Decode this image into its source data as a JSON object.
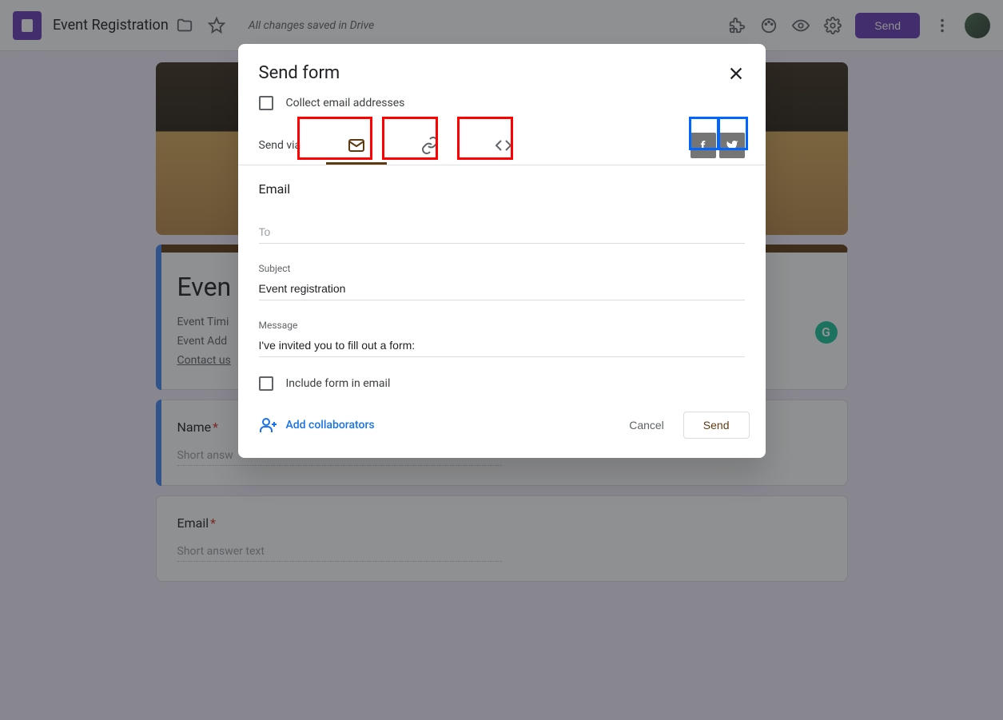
{
  "topbar": {
    "title": "Event Registration",
    "saved_text": "All changes saved in Drive",
    "send_label": "Send"
  },
  "form": {
    "title": "Even",
    "desc_line1": "Event Timi",
    "desc_line2": "Event Add",
    "desc_line3": "Contact us",
    "q1": {
      "title": "Name",
      "placeholder": "Short answ"
    },
    "q2": {
      "title": "Email",
      "placeholder": "Short answer text"
    }
  },
  "dialog": {
    "title": "Send form",
    "collect_label": "Collect email addresses",
    "send_via_label": "Send via",
    "email_heading": "Email",
    "to": {
      "label": "To",
      "value": ""
    },
    "subject": {
      "label": "Subject",
      "value": "Event registration"
    },
    "message": {
      "label": "Message",
      "value": "I've invited you to fill out a form:"
    },
    "include_label": "Include form in email",
    "add_collab": "Add collaborators",
    "cancel": "Cancel",
    "send": "Send"
  }
}
